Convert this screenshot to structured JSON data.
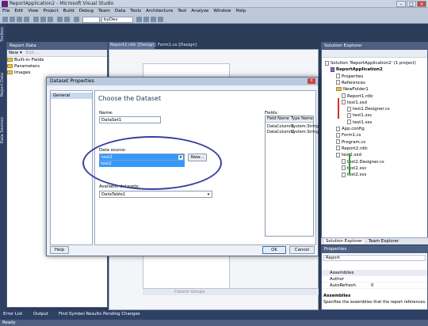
{
  "window": {
    "title": "ReportApplication2 - Microsoft Visual Studio",
    "buttons": [
      "–",
      "□",
      "×"
    ]
  },
  "menu": [
    "File",
    "Edit",
    "View",
    "Project",
    "Build",
    "Debug",
    "Team",
    "Data",
    "Tools",
    "Architecture",
    "Test",
    "Analyze",
    "Window",
    "Help"
  ],
  "toolbar": {
    "config_combo": "byDev"
  },
  "side_strip": {
    "items": [
      "Toolbox",
      "Report Data",
      "Data Sources"
    ]
  },
  "report_data": {
    "title": "Report Data",
    "toolbar_new": "New ▾",
    "toolbar_edit": "Edit...",
    "items": [
      "Built-in Fields",
      "Parameters",
      "Images"
    ]
  },
  "doc_tabs": [
    "Report2.rdlc [Design]",
    "Form1.cs [Design]"
  ],
  "designer": {
    "column_groups": "Column Groups"
  },
  "solution_explorer": {
    "title": "Solution Explorer",
    "items": [
      {
        "label": "Solution 'ReportApplication2' (1 project)",
        "indent": 0,
        "kind": "sln"
      },
      {
        "label": "ReportApplication2",
        "indent": 1,
        "kind": "proj",
        "bold": true
      },
      {
        "label": "Properties",
        "indent": 2,
        "kind": "file"
      },
      {
        "label": "References",
        "indent": 2,
        "kind": "file"
      },
      {
        "label": "NewFolder1",
        "indent": 2,
        "kind": "fold"
      },
      {
        "label": "Report1.rdlc",
        "indent": 3,
        "kind": "file"
      },
      {
        "label": "test1.xsd",
        "indent": 3,
        "kind": "file"
      },
      {
        "label": "test1.Designer.cs",
        "indent": 4,
        "kind": "file"
      },
      {
        "label": "test1.xsc",
        "indent": 4,
        "kind": "file"
      },
      {
        "label": "test1.xss",
        "indent": 4,
        "kind": "file"
      },
      {
        "label": "App.config",
        "indent": 2,
        "kind": "file"
      },
      {
        "label": "Form1.cs",
        "indent": 2,
        "kind": "file"
      },
      {
        "label": "Program.cs",
        "indent": 2,
        "kind": "file"
      },
      {
        "label": "Report2.rdlc",
        "indent": 2,
        "kind": "file"
      },
      {
        "label": "test2.xsd",
        "indent": 2,
        "kind": "file"
      },
      {
        "label": "test2.Designer.cs",
        "indent": 3,
        "kind": "file"
      },
      {
        "label": "test2.xsc",
        "indent": 3,
        "kind": "file"
      },
      {
        "label": "test2.xss",
        "indent": 3,
        "kind": "file"
      }
    ],
    "bottom_tabs": [
      "Solution Explorer",
      "Team Explorer"
    ]
  },
  "properties": {
    "title": "Properties",
    "object": "Report",
    "rows": [
      "Assemblies",
      "Author",
      "AutoRefresh"
    ],
    "autorefresh_value": "0",
    "desc_title": "Assemblies",
    "desc_text": "Specifies the assemblies that the report references."
  },
  "bottom_tabs": [
    "Error List",
    "Output",
    "Find Symbol Results",
    "Pending Changes"
  ],
  "status": "Ready",
  "dialog": {
    "title": "Dataset Properties",
    "nav_selected": "General",
    "heading": "Choose the Dataset",
    "name_label": "Name:",
    "name_value": "DataSet1",
    "datasource_label": "Data source:",
    "datasource_value": "test2",
    "datasource_dropdown_option": "test2",
    "new_button": "New...",
    "available_label": "Available datasets:",
    "available_value": "DataTable1",
    "fields_label": "Fields:",
    "fields_headers": [
      "Field Name",
      "Type Name"
    ],
    "fields_rows": [
      [
        "DataColumn1",
        "System.String"
      ],
      [
        "DataColumn2",
        "System.String"
      ]
    ],
    "help_button": "Help",
    "ok_button": "OK",
    "cancel_button": "Cancel"
  },
  "colors": {
    "highlight": "#3399ff",
    "annotation_ellipse": "#3a3fa1",
    "error_mark": "#d32f2f",
    "ok_mark": "#2e9a3c"
  }
}
